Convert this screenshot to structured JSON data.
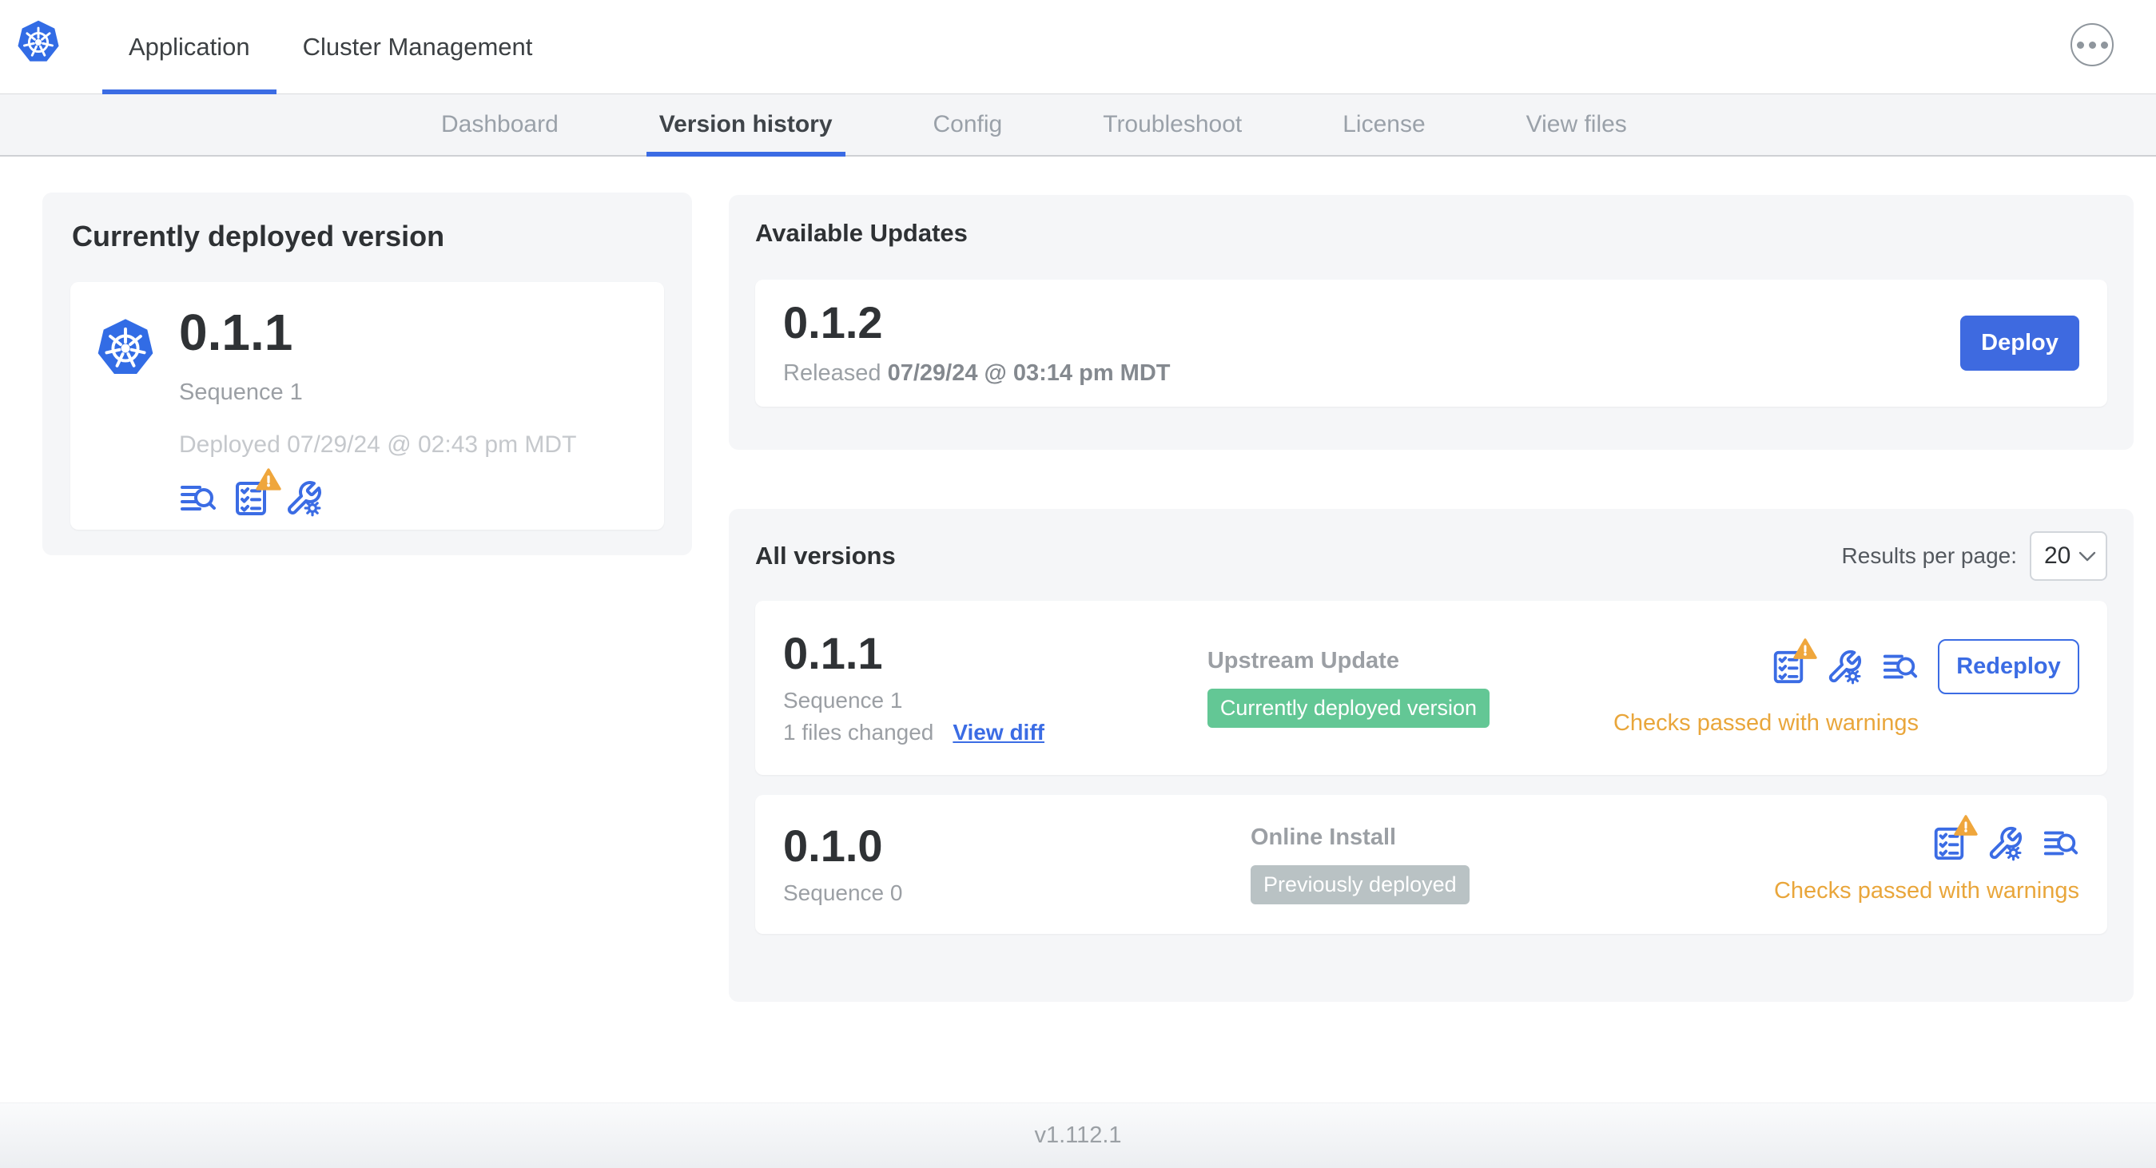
{
  "topbar": {
    "tabs": [
      {
        "label": "Application",
        "active": true
      },
      {
        "label": "Cluster Management",
        "active": false
      }
    ]
  },
  "subnav": {
    "tabs": [
      {
        "label": "Dashboard",
        "active": false
      },
      {
        "label": "Version history",
        "active": true
      },
      {
        "label": "Config",
        "active": false
      },
      {
        "label": "Troubleshoot",
        "active": false
      },
      {
        "label": "License",
        "active": false
      },
      {
        "label": "View files",
        "active": false
      }
    ]
  },
  "deployed_card": {
    "title": "Currently deployed version",
    "version": "0.1.1",
    "sequence": "Sequence 1",
    "deployed_at": "Deployed 07/29/24 @ 02:43 pm MDT"
  },
  "available_updates": {
    "title": "Available Updates",
    "version": "0.1.2",
    "released_prefix": "Released",
    "released_date": "07/29/24 @ 03:14 pm MDT",
    "deploy_label": "Deploy"
  },
  "all_versions": {
    "title": "All versions",
    "results_per_page_label": "Results per page:",
    "results_per_page_value": "20",
    "rows": [
      {
        "version": "0.1.1",
        "sequence": "Sequence 1",
        "files_changed": "1 files changed",
        "view_diff_label": "View diff",
        "source": "Upstream Update",
        "badge": "Currently deployed version",
        "badge_type": "green",
        "status": "Checks passed with warnings",
        "action_label": "Redeploy"
      },
      {
        "version": "0.1.0",
        "sequence": "Sequence 0",
        "source": "Online Install",
        "badge": "Previously deployed",
        "badge_type": "gray",
        "status": "Checks passed with warnings"
      }
    ]
  },
  "footer": {
    "app_version": "v1.112.1"
  },
  "icons": {
    "brand": "kubernetes-logo",
    "version_icons": [
      "release-notes-icon",
      "preflight-checks-icon",
      "edit-config-icon"
    ],
    "warning_overlay": "warning-triangle-icon",
    "menu": "ellipsis-icon"
  },
  "colors": {
    "accent_blue": "#3b6ce4",
    "deploy_button": "#3e6ae0",
    "badge_green": "#63c795",
    "badge_gray": "#b9c2c4",
    "warning_amber": "#e9a63b",
    "card_background": "#f5f6f8",
    "kubernetes_blue": "#326ce5"
  }
}
